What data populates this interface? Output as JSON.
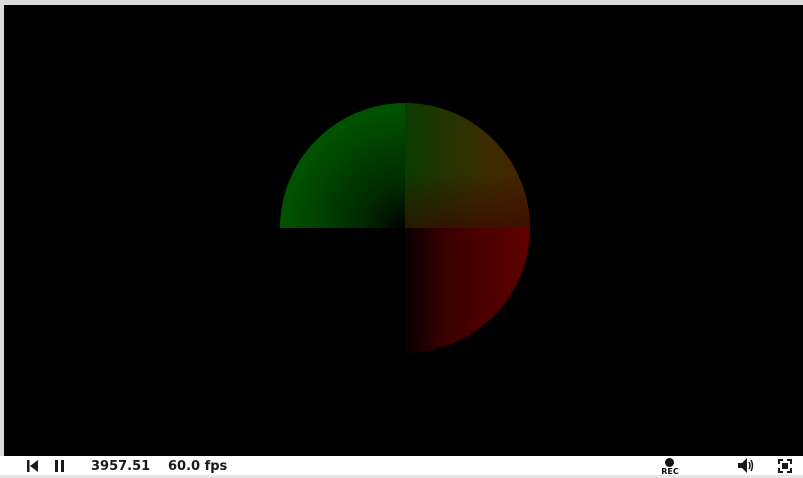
{
  "player": {
    "time": "3957.51",
    "fps": "60.0 fps",
    "rec_label": "REC"
  },
  "canvas": {
    "background": "#000000",
    "disc_colors": {
      "top_left": "#005200",
      "top_right": "#3a3000",
      "bottom_right": "#5f0000",
      "bottom_left": "#000000"
    }
  },
  "icons": {
    "rewind": "skip-back-icon",
    "pause": "pause-icon",
    "record": "record-icon",
    "volume": "volume-icon",
    "fullscreen": "fullscreen-icon"
  }
}
